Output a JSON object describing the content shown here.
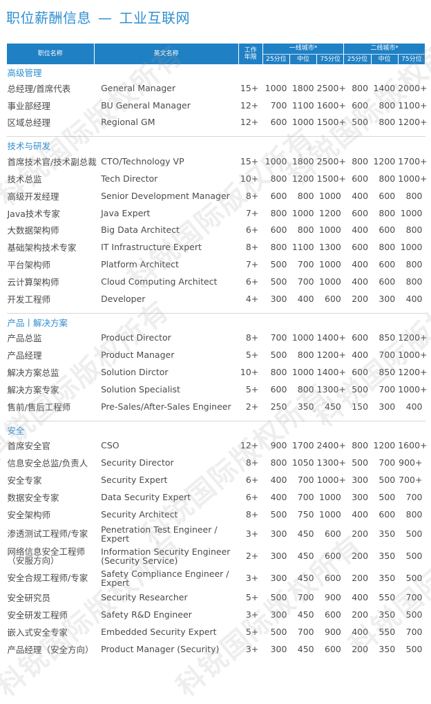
{
  "title": {
    "main": "职位薪酬信息",
    "dash": "—",
    "sub": "工业互联网"
  },
  "header": {
    "cn": "职位名称",
    "en": "英文名称",
    "years": "工作\n年限",
    "tier1": "一线城市*",
    "tier2": "二线城市*",
    "p25": "25分位",
    "p50": "中位",
    "p75": "75分位"
  },
  "watermark": "科锐国际版权所有",
  "sections": [
    {
      "name": "高级管理",
      "rows": [
        {
          "cn": "总经理/首席代表",
          "en": "General Manager",
          "yr": "15+",
          "a": "1000",
          "b": "1800",
          "c": "2500+",
          "d": "800",
          "e": "1400",
          "f": "2000+"
        },
        {
          "cn": "事业部经理",
          "en": "BU General Manager",
          "yr": "12+",
          "a": "700",
          "b": "1100",
          "c": "1600+",
          "d": "600",
          "e": "800",
          "f": "1100+"
        },
        {
          "cn": "区域总经理",
          "en": "Regional GM",
          "yr": "12+",
          "a": "600",
          "b": "1000",
          "c": "1500+",
          "d": "500",
          "e": "800",
          "f": "1200+"
        }
      ]
    },
    {
      "name": "技术与研发",
      "rows": [
        {
          "cn": "首席技术官/技术副总裁",
          "en": "CTO/Technology VP",
          "yr": "15+",
          "a": "1000",
          "b": "1800",
          "c": "2500+",
          "d": "800",
          "e": "1200",
          "f": "1700+"
        },
        {
          "cn": "技术总监",
          "en": "Tech Director",
          "yr": "10+",
          "a": "800",
          "b": "1200",
          "c": "1500+",
          "d": "600",
          "e": "800",
          "f": "1000+"
        },
        {
          "cn": "高级开发经理",
          "en": "Senior Development Manager",
          "yr": "8+",
          "a": "600",
          "b": "800",
          "c": "1000",
          "d": "400",
          "e": "600",
          "f": "800"
        },
        {
          "cn": "Java技术专家",
          "en": "Java Expert",
          "yr": "7+",
          "a": "800",
          "b": "1000",
          "c": "1200",
          "d": "600",
          "e": "800",
          "f": "1000"
        },
        {
          "cn": "大数据架构师",
          "en": "Big Data Architect",
          "yr": "6+",
          "a": "600",
          "b": "800",
          "c": "1000",
          "d": "400",
          "e": "600",
          "f": "800"
        },
        {
          "cn": "基础架构技术专家",
          "en": "IT Infrastructure Expert",
          "yr": "8+",
          "a": "800",
          "b": "1100",
          "c": "1300",
          "d": "600",
          "e": "800",
          "f": "1000"
        },
        {
          "cn": "平台架构师",
          "en": "Platform Architect",
          "yr": "7+",
          "a": "500",
          "b": "700",
          "c": "1000",
          "d": "400",
          "e": "600",
          "f": "800"
        },
        {
          "cn": "云计算架构师",
          "en": "Cloud Computing Architect",
          "yr": "6+",
          "a": "500",
          "b": "700",
          "c": "1000",
          "d": "400",
          "e": "600",
          "f": "800"
        },
        {
          "cn": "开发工程师",
          "en": "Developer",
          "yr": "4+",
          "a": "300",
          "b": "400",
          "c": "600",
          "d": "200",
          "e": "300",
          "f": "400"
        }
      ]
    },
    {
      "name": "产品丨解决方案",
      "rows": [
        {
          "cn": "产品总监",
          "en": "Product Director",
          "yr": "8+",
          "a": "700",
          "b": "1000",
          "c": "1400+",
          "d": "600",
          "e": "850",
          "f": "1200+"
        },
        {
          "cn": "产品经理",
          "en": "Product Manager",
          "yr": "5+",
          "a": "500",
          "b": "800",
          "c": "1200+",
          "d": "400",
          "e": "700",
          "f": "1000+"
        },
        {
          "cn": "解决方案总监",
          "en": "Solution Dirctor",
          "yr": "10+",
          "a": "800",
          "b": "1000",
          "c": "1400+",
          "d": "600",
          "e": "850",
          "f": "1200+"
        },
        {
          "cn": "解决方案专家",
          "en": "Solution Specialist",
          "yr": "5+",
          "a": "600",
          "b": "800",
          "c": "1300+",
          "d": "500",
          "e": "700",
          "f": "1000+"
        },
        {
          "cn": "售前/售后工程师",
          "en": "Pre-Sales/After-Sales Engineer",
          "yr": "2+",
          "a": "250",
          "b": "350",
          "c": "450",
          "d": "150",
          "e": "300",
          "f": "400"
        }
      ]
    },
    {
      "name": "安全",
      "rows": [
        {
          "cn": "首席安全官",
          "en": "CSO",
          "yr": "12+",
          "a": "900",
          "b": "1700",
          "c": "2400+",
          "d": "800",
          "e": "1200",
          "f": "1600+"
        },
        {
          "cn": "信息安全总监/负责人",
          "en": "Security Director",
          "yr": "8+",
          "a": "800",
          "b": "1050",
          "c": "1300+",
          "d": "500",
          "e": "700",
          "f": "900+"
        },
        {
          "cn": "安全专家",
          "en": "Security Expert",
          "yr": "6+",
          "a": "400",
          "b": "700",
          "c": "1000+",
          "d": "300",
          "e": "500",
          "f": "700+"
        },
        {
          "cn": "数据安全专家",
          "en": "Data Security Expert",
          "yr": "6+",
          "a": "400",
          "b": "700",
          "c": "1000",
          "d": "300",
          "e": "500",
          "f": "700"
        },
        {
          "cn": "安全架构师",
          "en": "Security Architect",
          "yr": "8+",
          "a": "500",
          "b": "750",
          "c": "1000",
          "d": "400",
          "e": "600",
          "f": "800"
        },
        {
          "cn": "渗透测试工程师/专家",
          "en": "Penetration Test Engineer / Expert",
          "yr": "3+",
          "a": "300",
          "b": "450",
          "c": "600",
          "d": "200",
          "e": "350",
          "f": "500",
          "tall": true
        },
        {
          "cn": "网络信息安全工程师（安服方向）",
          "en": "Information Security Engineer (Security Service)",
          "yr": "2+",
          "a": "300",
          "b": "450",
          "c": "600",
          "d": "200",
          "e": "350",
          "f": "500",
          "tall": true
        },
        {
          "cn": "安全合规工程师/专家",
          "en": "Safety Compliance Engineer / Expert",
          "yr": "3+",
          "a": "300",
          "b": "450",
          "c": "600",
          "d": "200",
          "e": "350",
          "f": "500",
          "tall": true
        },
        {
          "cn": "安全研究员",
          "en": "Security Researcher",
          "yr": "5+",
          "a": "500",
          "b": "700",
          "c": "900",
          "d": "400",
          "e": "550",
          "f": "700"
        },
        {
          "cn": "安全研发工程师",
          "en": "Safety R&D Engineer",
          "yr": "3+",
          "a": "300",
          "b": "450",
          "c": "600",
          "d": "200",
          "e": "350",
          "f": "500"
        },
        {
          "cn": "嵌入式安全专家",
          "en": "Embedded Security Expert",
          "yr": "5+",
          "a": "500",
          "b": "700",
          "c": "900",
          "d": "400",
          "e": "550",
          "f": "700"
        },
        {
          "cn": "产品经理（安全方向）",
          "en": "Product Manager (Security)",
          "yr": "3+",
          "a": "300",
          "b": "450",
          "c": "600",
          "d": "200",
          "e": "350",
          "f": "500"
        }
      ]
    }
  ]
}
